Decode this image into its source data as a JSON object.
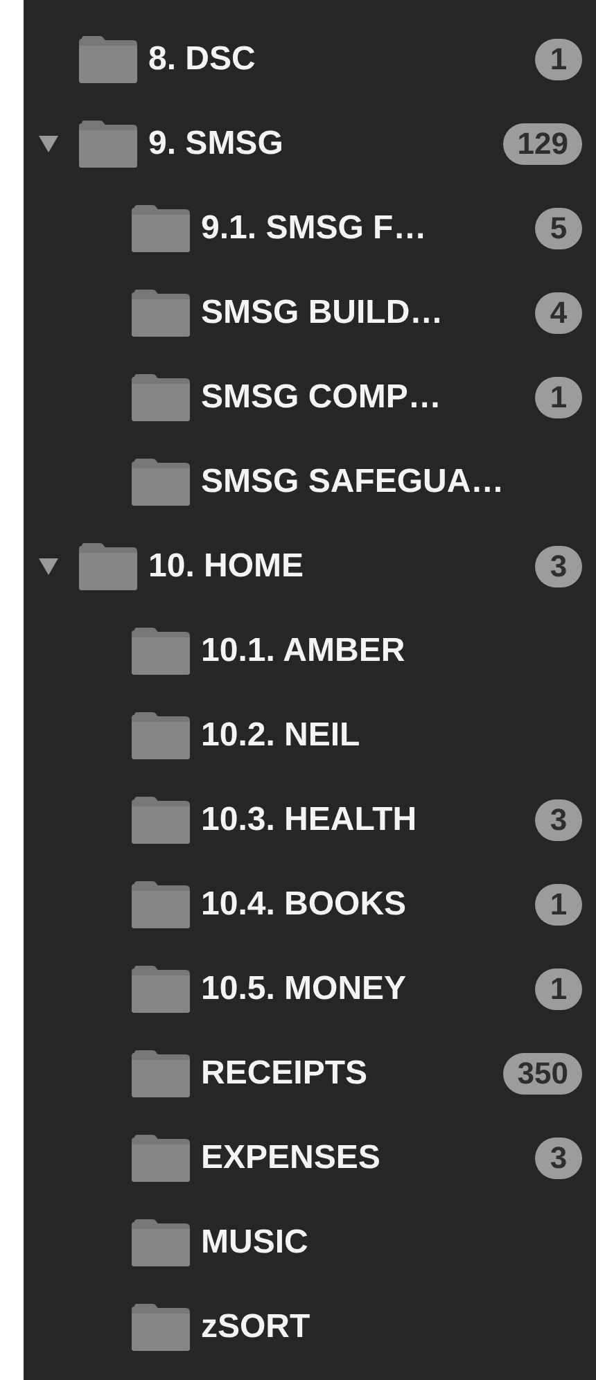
{
  "sidebar": {
    "items": [
      {
        "label": "8. DSC",
        "count": "1"
      },
      {
        "label": "9. SMSG",
        "count": "129",
        "expanded": true,
        "children": [
          {
            "label": "9.1. SMSG F…",
            "count": "5"
          },
          {
            "label": "SMSG BUILD…",
            "count": "4"
          },
          {
            "label": "SMSG COMP…",
            "count": "1"
          },
          {
            "label": "SMSG SAFEGUA…"
          }
        ]
      },
      {
        "label": "10. HOME",
        "count": "3",
        "expanded": true,
        "children": [
          {
            "label": "10.1. AMBER"
          },
          {
            "label": "10.2. NEIL"
          },
          {
            "label": "10.3. HEALTH",
            "count": "3"
          },
          {
            "label": "10.4. BOOKS",
            "count": "1"
          },
          {
            "label": "10.5. MONEY",
            "count": "1"
          },
          {
            "label": "RECEIPTS",
            "count": "350"
          },
          {
            "label": "EXPENSES",
            "count": "3"
          },
          {
            "label": "MUSIC"
          },
          {
            "label": "zSORT"
          }
        ]
      }
    ]
  }
}
